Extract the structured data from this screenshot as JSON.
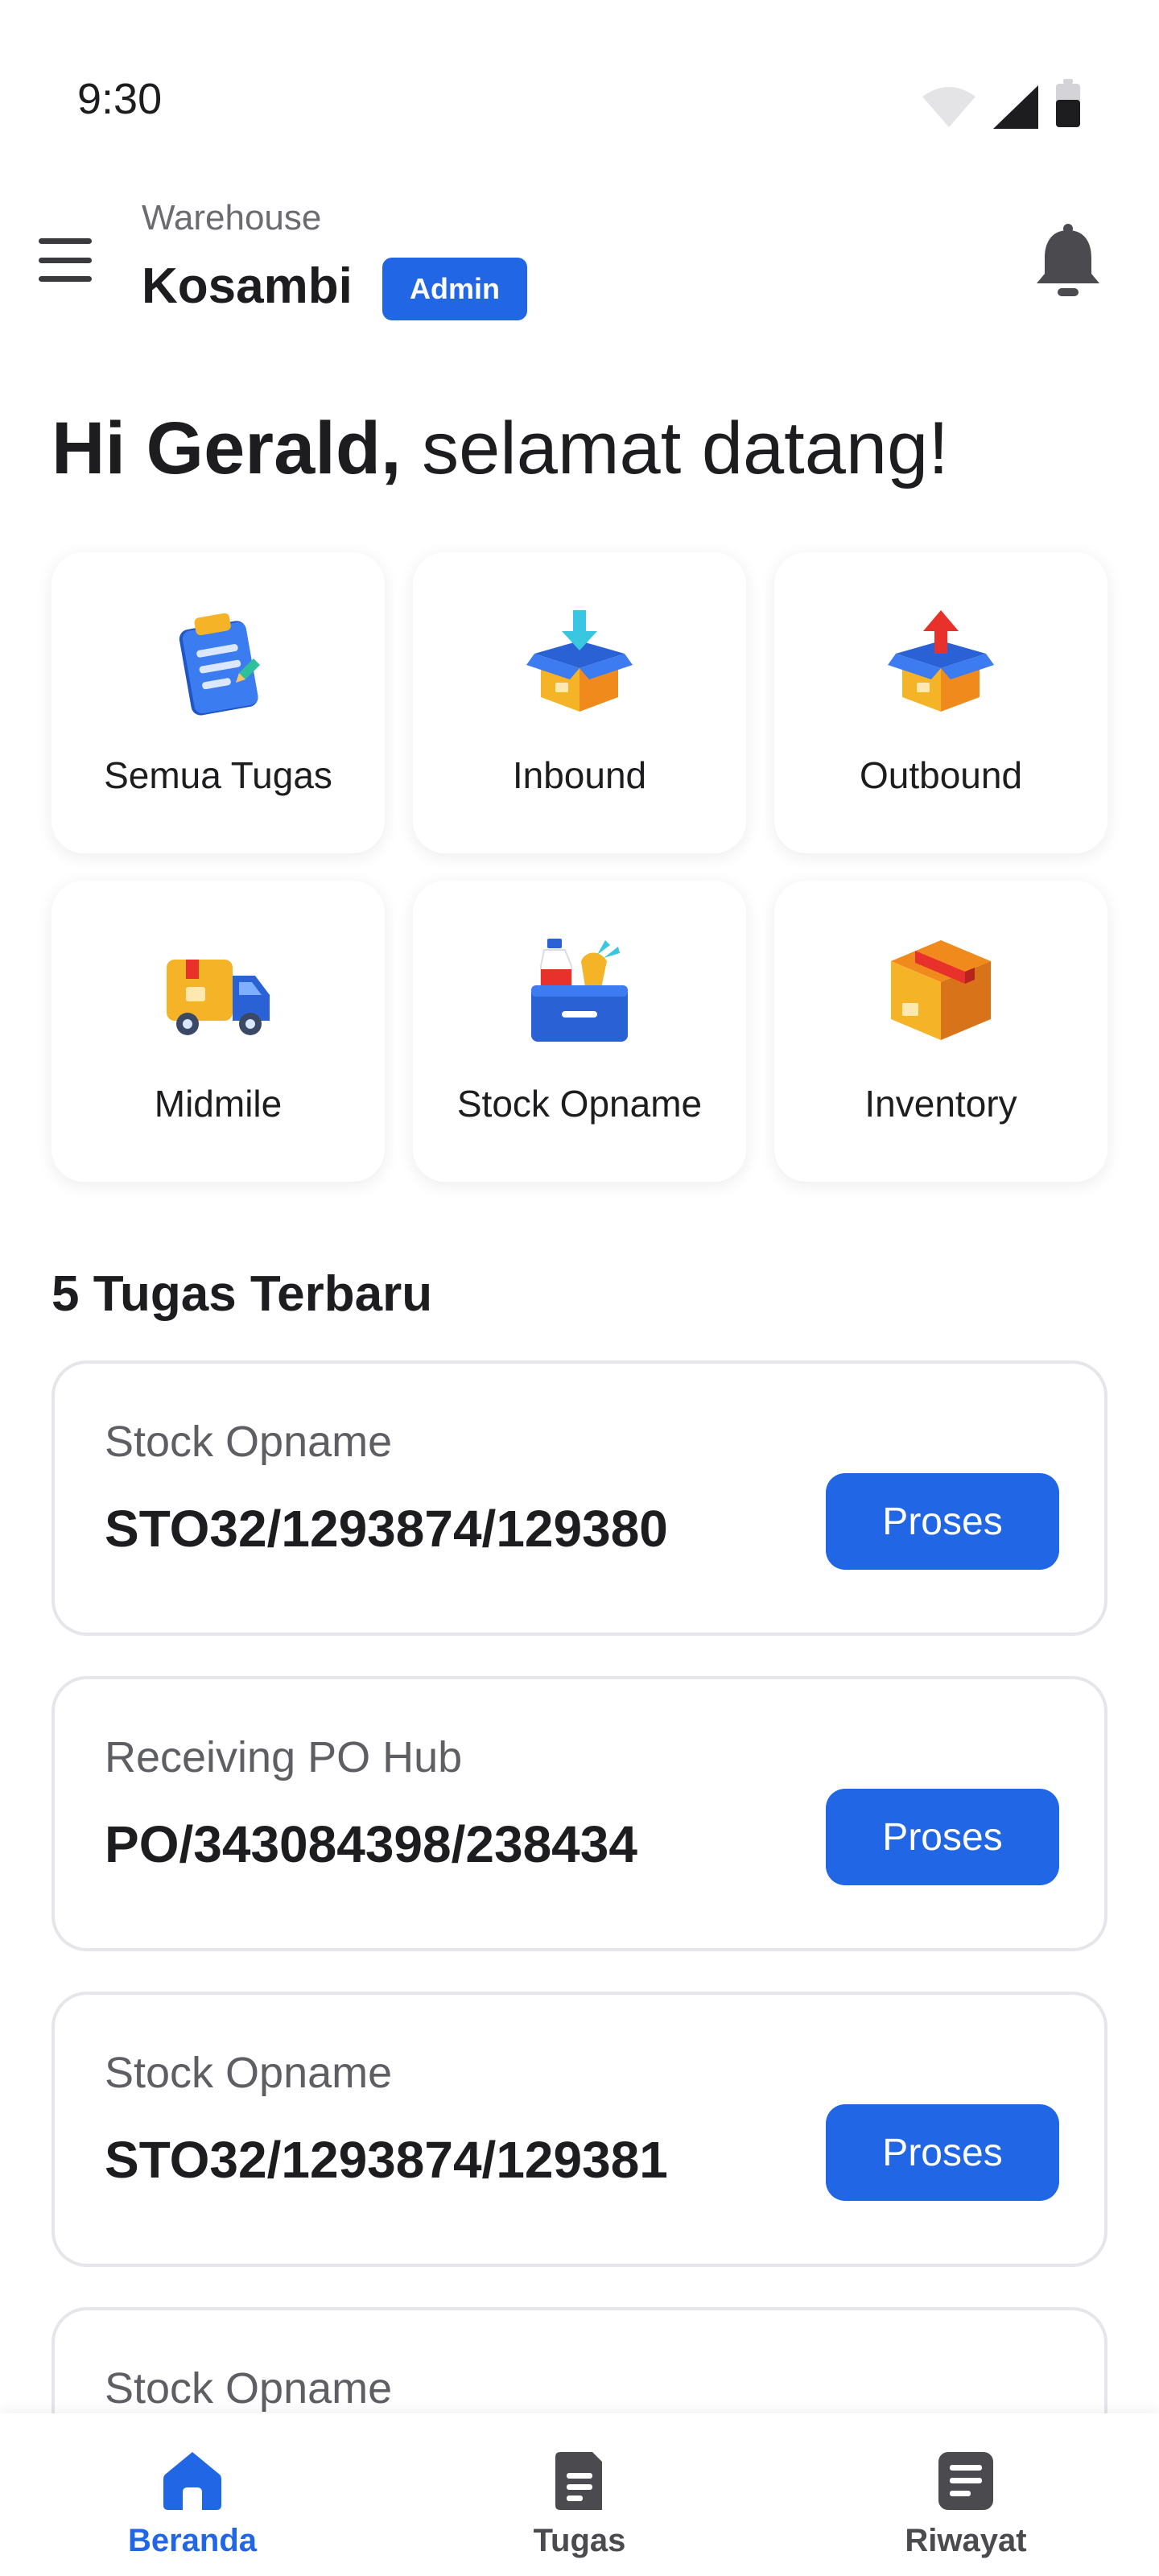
{
  "status_bar": {
    "time": "9:30"
  },
  "header": {
    "warehouse_label": "Warehouse",
    "warehouse_name": "Kosambi",
    "role_badge": "Admin"
  },
  "greeting": {
    "name": "Hi Gerald,",
    "message": "selamat datang!"
  },
  "menu": [
    {
      "label": "Semua Tugas",
      "icon": "clipboard-icon"
    },
    {
      "label": "Inbound",
      "icon": "box-inbound-icon"
    },
    {
      "label": "Outbound",
      "icon": "box-outbound-icon"
    },
    {
      "label": "Midmile",
      "icon": "truck-icon"
    },
    {
      "label": "Stock Opname",
      "icon": "stock-opname-box-icon"
    },
    {
      "label": "Inventory",
      "icon": "package-icon"
    }
  ],
  "tasks_section": {
    "title": "5 Tugas Terbaru",
    "items": [
      {
        "type": "Stock Opname",
        "code": "STO32/1293874/129380",
        "action": "Proses"
      },
      {
        "type": "Receiving PO Hub",
        "code": "PO/343084398/238434",
        "action": "Proses"
      },
      {
        "type": "Stock Opname",
        "code": "STO32/1293874/129381",
        "action": "Proses"
      },
      {
        "type": "Stock Opname",
        "code": "",
        "action": ""
      }
    ]
  },
  "bottom_nav": [
    {
      "label": "Beranda",
      "icon": "home-icon",
      "active": true
    },
    {
      "label": "Tugas",
      "icon": "task-document-icon",
      "active": false
    },
    {
      "label": "Riwayat",
      "icon": "history-document-icon",
      "active": false
    }
  ],
  "colors": {
    "primary": "#2167e5",
    "text_dark": "#1d1d1f",
    "text_muted": "#5e5e63",
    "inactive_nav": "#4a4a4f"
  }
}
